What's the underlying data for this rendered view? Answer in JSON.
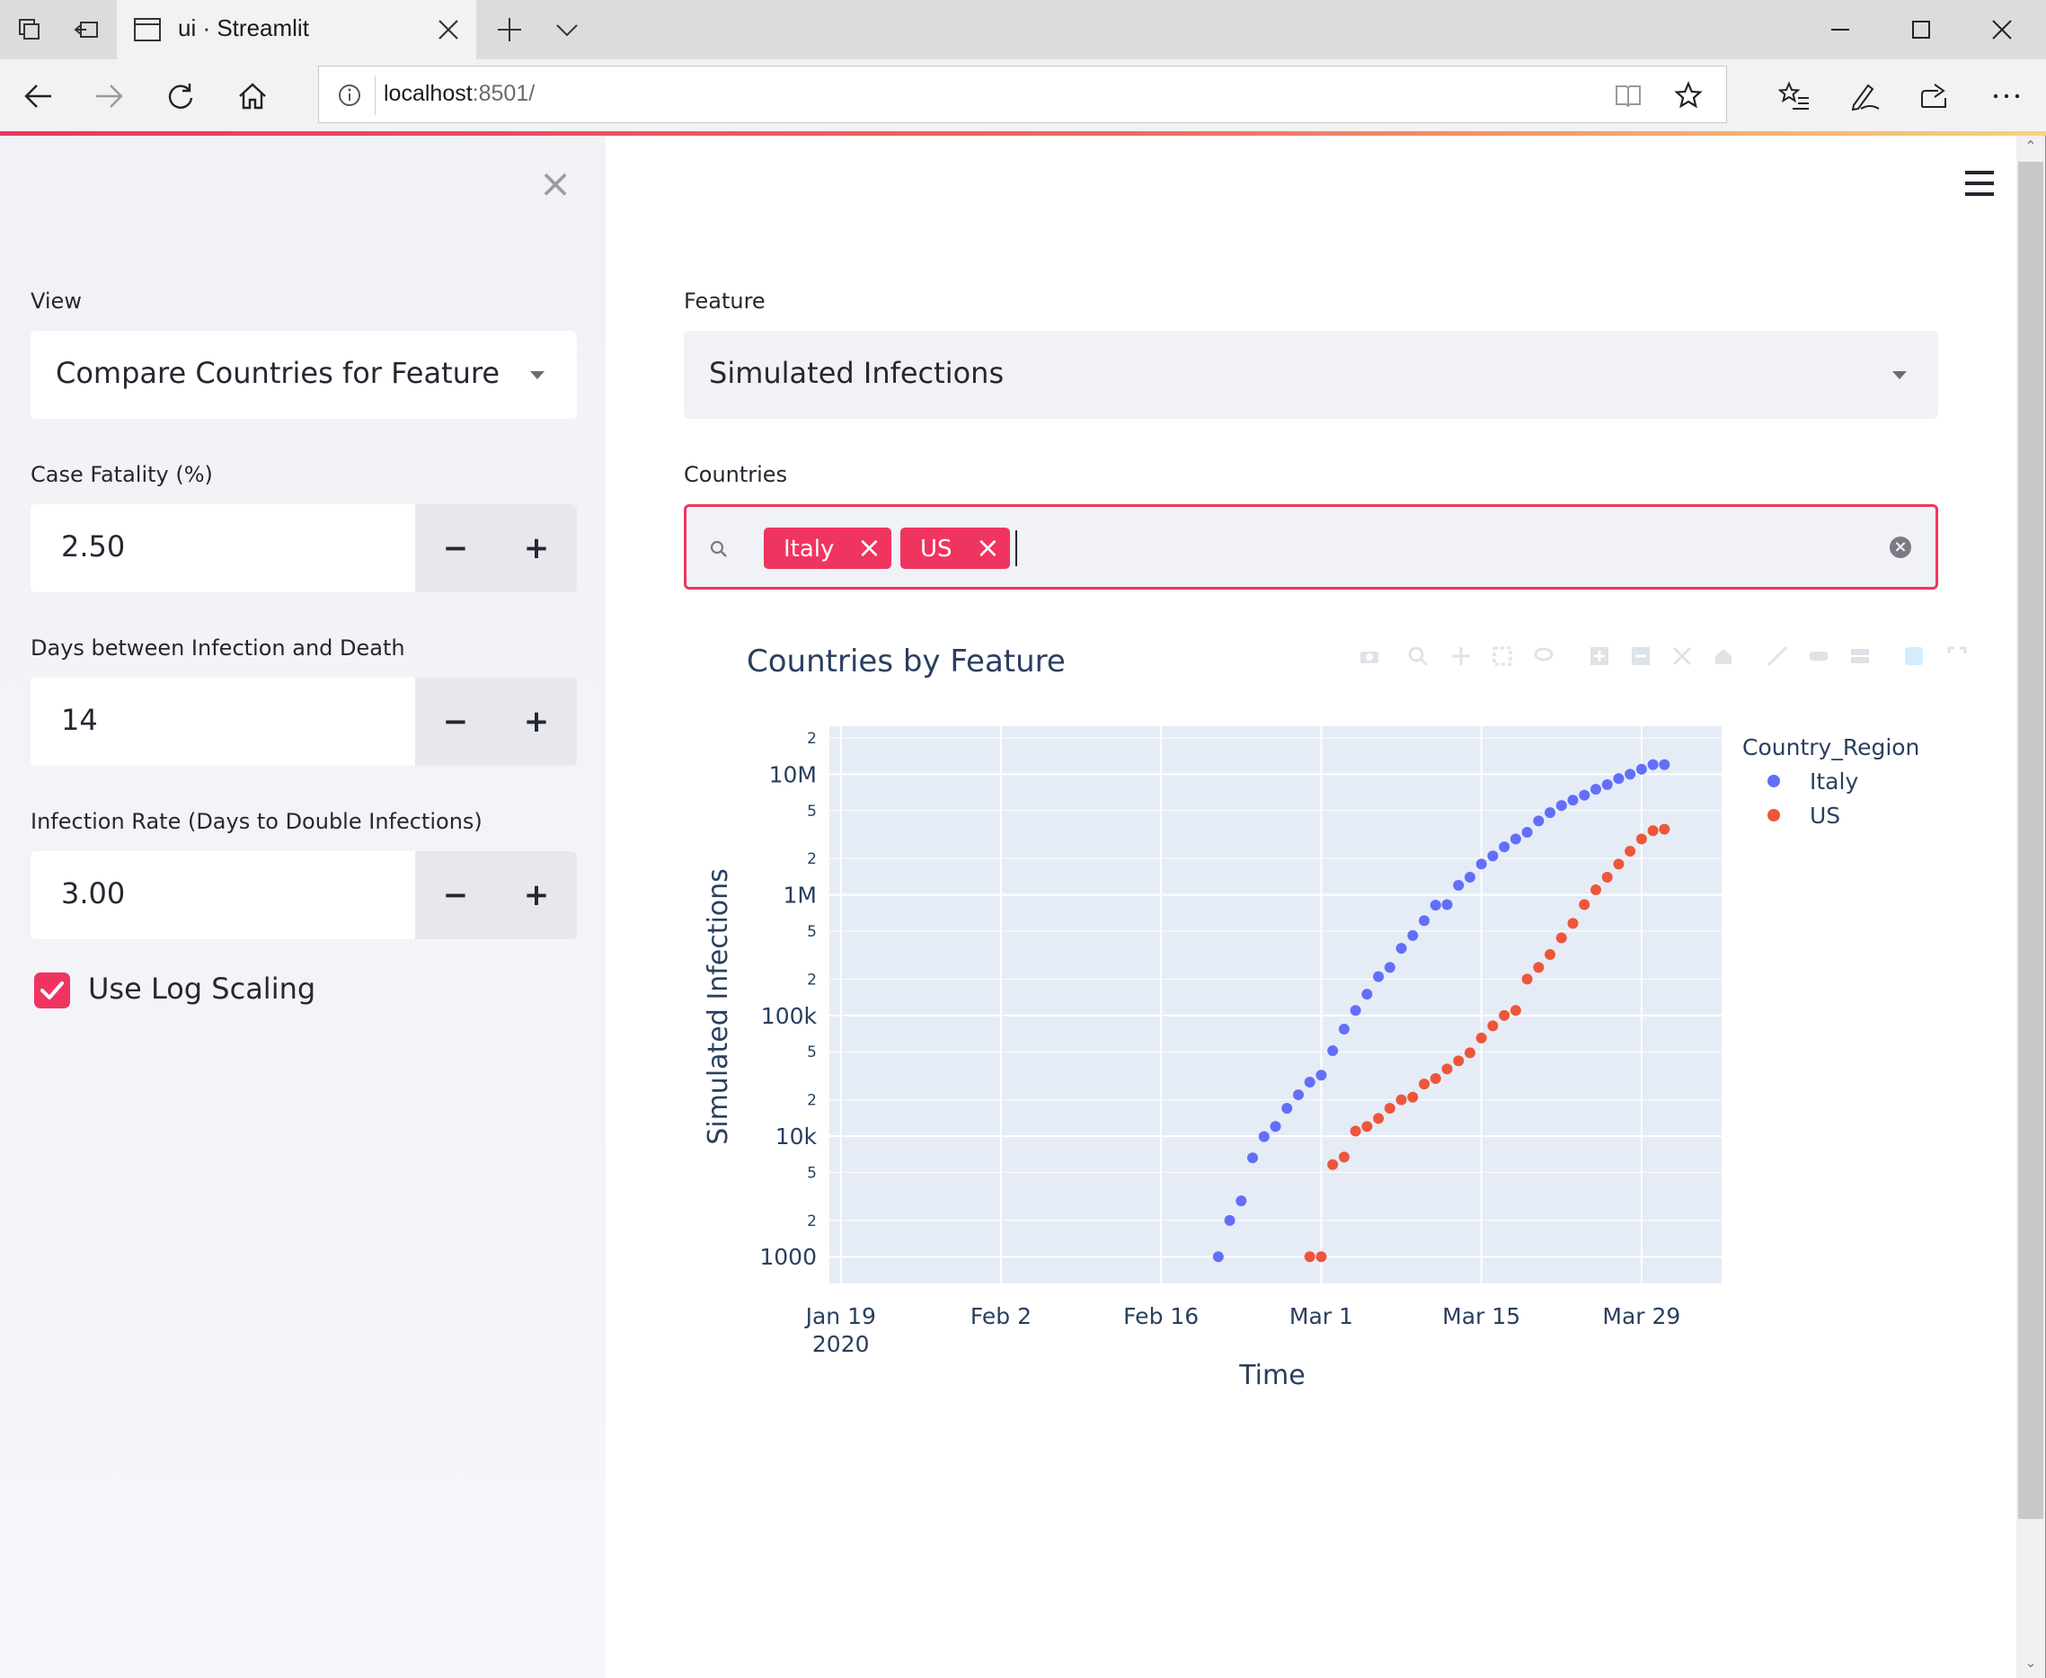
{
  "browser": {
    "tab_title": "ui · Streamlit",
    "url_host": "localhost",
    "url_port": ":8501/"
  },
  "sidebar": {
    "view_label": "View",
    "view_value": "Compare Countries for Feature",
    "case_fatality_label": "Case Fatality (%)",
    "case_fatality_value": "2.50",
    "days_label": "Days between Infection and Death",
    "days_value": "14",
    "infection_rate_label": "Infection Rate (Days to Double Infections)",
    "infection_rate_value": "3.00",
    "minus": "−",
    "plus": "+",
    "log_scaling_label": "Use Log Scaling",
    "log_scaling_checked": true
  },
  "main": {
    "feature_label": "Feature",
    "feature_value": "Simulated Infections",
    "countries_label": "Countries",
    "selected_countries": [
      "Italy",
      "US"
    ]
  },
  "colors": {
    "accent": "#f03460",
    "italy": "#636efa",
    "us": "#ef553b",
    "plot_bg": "#e5ecf6"
  },
  "chart_data": {
    "type": "scatter",
    "title": "Countries by Feature",
    "xlabel": "Time",
    "ylabel": "Simulated Infections",
    "yscale": "log",
    "legend_title": "Country_Region",
    "legend_position": "right",
    "grid": true,
    "xlim": [
      "2020-01-18",
      "2020-04-05"
    ],
    "ylim": [
      600,
      25000000
    ],
    "x_ticks": [
      "2020-01-19",
      "2020-02-02",
      "2020-02-16",
      "2020-03-01",
      "2020-03-15",
      "2020-03-29"
    ],
    "x_tick_labels": [
      "Jan 19",
      "Feb 2",
      "Feb 16",
      "Mar 1",
      "Mar 15",
      "Mar 29"
    ],
    "x_tick_sublabel": "2020",
    "y_major_ticks": [
      1000,
      10000,
      100000,
      1000000,
      10000000
    ],
    "y_major_labels": [
      "1000",
      "10k",
      "100k",
      "1M",
      "10M"
    ],
    "y_minor_ticks": [
      2000,
      5000,
      20000,
      50000,
      200000,
      500000,
      2000000,
      5000000,
      20000000
    ],
    "y_minor_labels": [
      "2",
      "5",
      "2",
      "5",
      "2",
      "5",
      "2",
      "5",
      "2"
    ],
    "series": [
      {
        "name": "Italy",
        "x": [
          "2020-02-21",
          "2020-02-22",
          "2020-02-23",
          "2020-02-24",
          "2020-02-25",
          "2020-02-26",
          "2020-02-27",
          "2020-02-28",
          "2020-02-29",
          "2020-03-01",
          "2020-03-02",
          "2020-03-03",
          "2020-03-04",
          "2020-03-05",
          "2020-03-06",
          "2020-03-07",
          "2020-03-08",
          "2020-03-09",
          "2020-03-10",
          "2020-03-11",
          "2020-03-12",
          "2020-03-13",
          "2020-03-14",
          "2020-03-15",
          "2020-03-16",
          "2020-03-17",
          "2020-03-18",
          "2020-03-19",
          "2020-03-20",
          "2020-03-21",
          "2020-03-22",
          "2020-03-23",
          "2020-03-24",
          "2020-03-25",
          "2020-03-26",
          "2020-03-27",
          "2020-03-28",
          "2020-03-29",
          "2020-03-30",
          "2020-03-31"
        ],
        "y": [
          1000,
          2000,
          2900,
          6600,
          9900,
          12000,
          17000,
          22000,
          28000,
          32000,
          51000,
          77000,
          110000,
          150000,
          210000,
          250000,
          360000,
          460000,
          610000,
          820000,
          830000,
          1200000,
          1400000,
          1800000,
          2100000,
          2500000,
          2900000,
          3300000,
          4100000,
          4800000,
          5500000,
          6100000,
          6700000,
          7500000,
          8200000,
          9200000,
          10000000,
          11000000,
          12000000,
          12000000
        ]
      },
      {
        "name": "US",
        "x": [
          "2020-02-29",
          "2020-03-01",
          "2020-03-02",
          "2020-03-03",
          "2020-03-04",
          "2020-03-05",
          "2020-03-06",
          "2020-03-07",
          "2020-03-08",
          "2020-03-09",
          "2020-03-10",
          "2020-03-11",
          "2020-03-12",
          "2020-03-13",
          "2020-03-14",
          "2020-03-15",
          "2020-03-16",
          "2020-03-17",
          "2020-03-18",
          "2020-03-19",
          "2020-03-20",
          "2020-03-21",
          "2020-03-22",
          "2020-03-23",
          "2020-03-24",
          "2020-03-25",
          "2020-03-26",
          "2020-03-27",
          "2020-03-28",
          "2020-03-29",
          "2020-03-30",
          "2020-03-31"
        ],
        "y": [
          1000,
          1000,
          5800,
          6700,
          11000,
          12000,
          14000,
          17000,
          20000,
          21000,
          27000,
          30000,
          36000,
          42000,
          49000,
          65000,
          82000,
          100000,
          110000,
          200000,
          250000,
          320000,
          440000,
          580000,
          830000,
          1100000,
          1400000,
          1800000,
          2300000,
          2900000,
          3400000,
          3500000
        ]
      }
    ]
  }
}
